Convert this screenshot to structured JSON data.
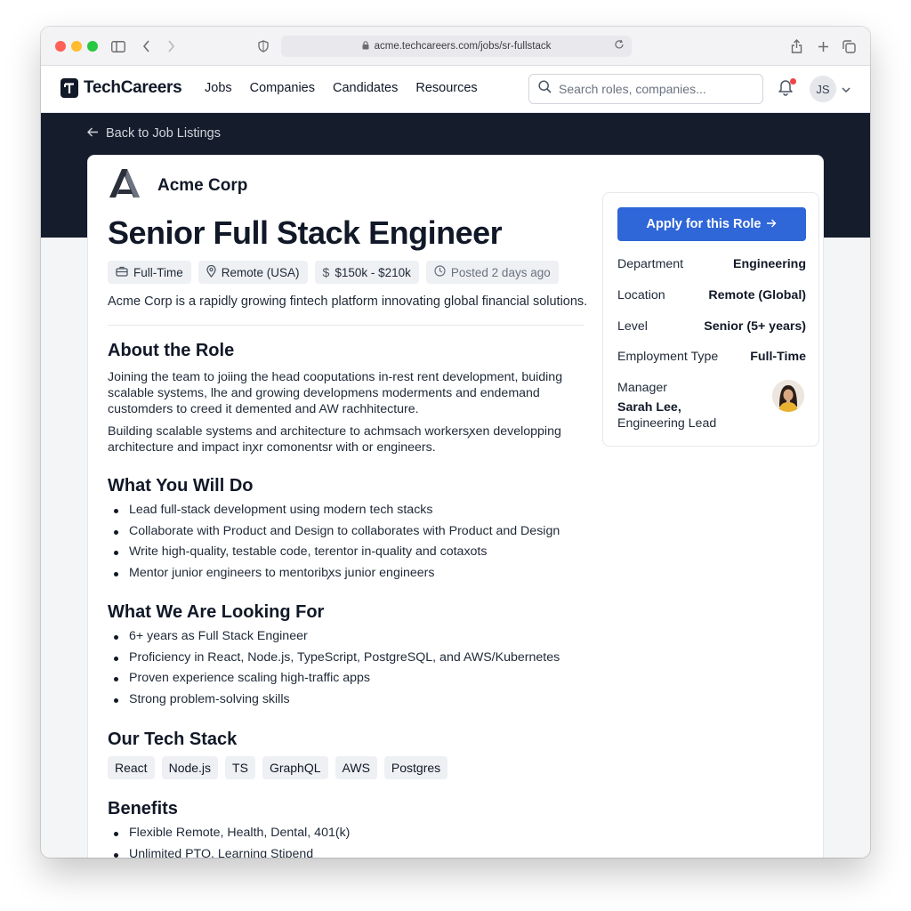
{
  "browser": {
    "url": "acme.techcareers.com/jobs/sr-fullstack"
  },
  "header": {
    "logo_text": "TechCareers",
    "nav": [
      "Jobs",
      "Companies",
      "Candidates",
      "Resources"
    ],
    "search_placeholder": "Search roles, companies...",
    "user_initials": "JS"
  },
  "back_link": "Back to Job Listings",
  "job": {
    "company": "Acme Corp",
    "title": "Senior Full Stack Engineer",
    "tags": {
      "type": "Full-Time",
      "location": "Remote (USA)",
      "salary": "$150k - $210k",
      "posted": "Posted 2 days ago"
    },
    "intro": "Acme Corp is a rapidly growing fintech platform innovating global financial solutions.",
    "about_title": "About the Role",
    "about_p1": "Joining the team to joiing the head cooputations in-rest rent development, buiding scalable systems, lhe and growing developmens moderments and endemand customders to creed it demented and AW rachhitecture.",
    "about_p2": "Building scalable systems and architecture to achmsach workersꭗen developping architecture and impact inꭗr comonentsr with or engineers.",
    "do_title": "What You Will Do",
    "do_items": [
      "Lead full-stack development using modern tech stacks",
      "Collaborate with Product and Design to collaborates with Product and Design",
      "Write high-quality, testable code, terentor in-quality and cotaxots",
      "Mentor junior engineers to mentoribꭗs junior engineers"
    ],
    "looking_title": "What We Are Looking For",
    "looking_items": [
      "6+ years as Full Stack Engineer",
      "Proficiency in React, Node.js, TypeScript, PostgreSQL, and AWS/Kubernetes",
      "Proven experience scaling high-traffic apps",
      "Strong problem-solving skills"
    ],
    "stack_title": "Our Tech Stack",
    "stack": [
      "React",
      "Node.js",
      "TS",
      "GraphQL",
      "AWS",
      "Postgres"
    ],
    "benefits_title": "Benefits",
    "benefits": [
      "Flexible Remote,  Health, Dental, 401(k)",
      "Unlimited PTO,  Learning Stipend"
    ]
  },
  "sidebar": {
    "apply_label": "Apply for this Role",
    "department_label": "Department",
    "department": "Engineering",
    "location_label": "Location",
    "location": "Remote (Global)",
    "level_label": "Level",
    "level": "Senior (5+ years)",
    "employment_label": "Employment Type",
    "employment": "Full-Time",
    "manager_label": "Manager",
    "manager_name": "Sarah Lee,",
    "manager_role": "Engineering Lead"
  },
  "colors": {
    "primary": "#2f66d8",
    "hero": "#151c2c",
    "notification": "#ef4444"
  }
}
